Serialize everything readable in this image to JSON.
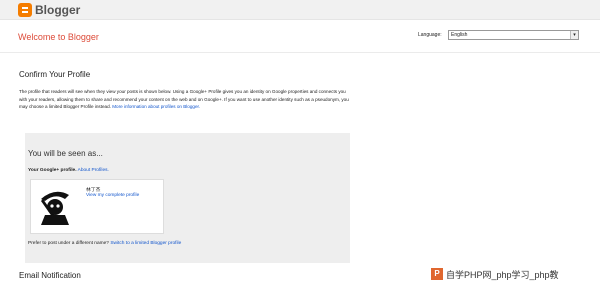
{
  "brand": {
    "name": "Blogger",
    "accent": "#f57d00"
  },
  "header": {
    "welcome": "Welcome to Blogger",
    "language_label": "Language:",
    "language_value": "English"
  },
  "profile": {
    "title": "Confirm Your Profile",
    "description": "The profile that readers will see when they view your posts is shown below. Using a Google+ Profile gives you an identity on Google properties and connects you with your readers, allowing them to share and recommend your content on the web and on Google+. If you want to use another identity such as a pseudonym, you may choose a limited Blogger Profile instead.",
    "more_link": "More information about profiles on Blogger."
  },
  "seen_as": {
    "title": "You will be seen as...",
    "gplus_label": "Your Google+ profile.",
    "about_link": "About Profiles.",
    "name": "林丁杰",
    "view_link": "View my complete profile",
    "prefer_text": "Prefer to post under a different name?",
    "switch_link": "Switch to a limited Blogger profile"
  },
  "email": {
    "title": "Email Notification"
  },
  "watermark": {
    "text": "自学PHP网_php学习_php教"
  }
}
